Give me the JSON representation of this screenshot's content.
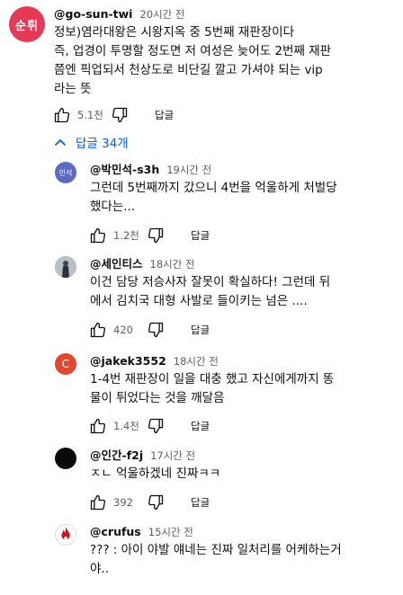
{
  "main_comment": {
    "avatar_text": "순튀",
    "avatar_color": "#e53958",
    "handle": "@go-sun-twi",
    "time": "20시간 전",
    "lines": [
      "정보)염라대왕은 시왕지옥 중 5번째 재판장이다",
      "즉, 업경이 투명할 정도면 저 여성은 늦어도 2번째 재판",
      "쯤엔 픽업되서 천상도로 비단길 깔고 가셔야 되는 vip",
      "라는 뜻"
    ],
    "likes": "5.1천",
    "reply_label": "답글"
  },
  "replies_toggle": {
    "label": "답글 34개",
    "color": "#065fd4"
  },
  "replies": [
    {
      "avatar_text": "민석",
      "avatar_color": "#5c6bc0",
      "handle": "@박민석-s3h",
      "time": "19시간 전",
      "lines": [
        "그런데 5번째까지 갔으니 4번을 억울하게 처벌당",
        "했다는..."
      ],
      "likes": "1.2천",
      "reply_label": "답글"
    },
    {
      "avatar_text": "",
      "avatar_color": "#9aa4ae",
      "handle": "@세인티스",
      "time": "18시간 전",
      "lines": [
        "이건 담당 저승사자 잘못이 확실하다! 그런데 뒤",
        "에서 김치국 대형 사발로 들이키는 넘은 ...."
      ],
      "likes": "420",
      "reply_label": "답글"
    },
    {
      "avatar_text": "C",
      "avatar_color": "#e0482f",
      "handle": "@jakek3552",
      "time": "18시간 전",
      "lines": [
        "1-4번 재판장이 일을 대충 했고 자신에게까지 똥",
        "물이 튀었다는 것을 깨달음"
      ],
      "likes": "1.4천",
      "reply_label": "답글"
    },
    {
      "avatar_text": "",
      "avatar_color": "#0a0a0a",
      "handle": "@인간-f2j",
      "time": "17시간 전",
      "lines": [
        "ㅈㄴ 억울하겠네 진짜ㅋㅋ"
      ],
      "likes": "392",
      "reply_label": "답글"
    },
    {
      "avatar_text": "",
      "avatar_color": "#c8161d",
      "handle": "@crufus",
      "time": "15시간 전",
      "lines": [
        "??? : 아이 야발 얘네는 진짜 일처리를 어케하는거",
        "야.."
      ]
    }
  ]
}
